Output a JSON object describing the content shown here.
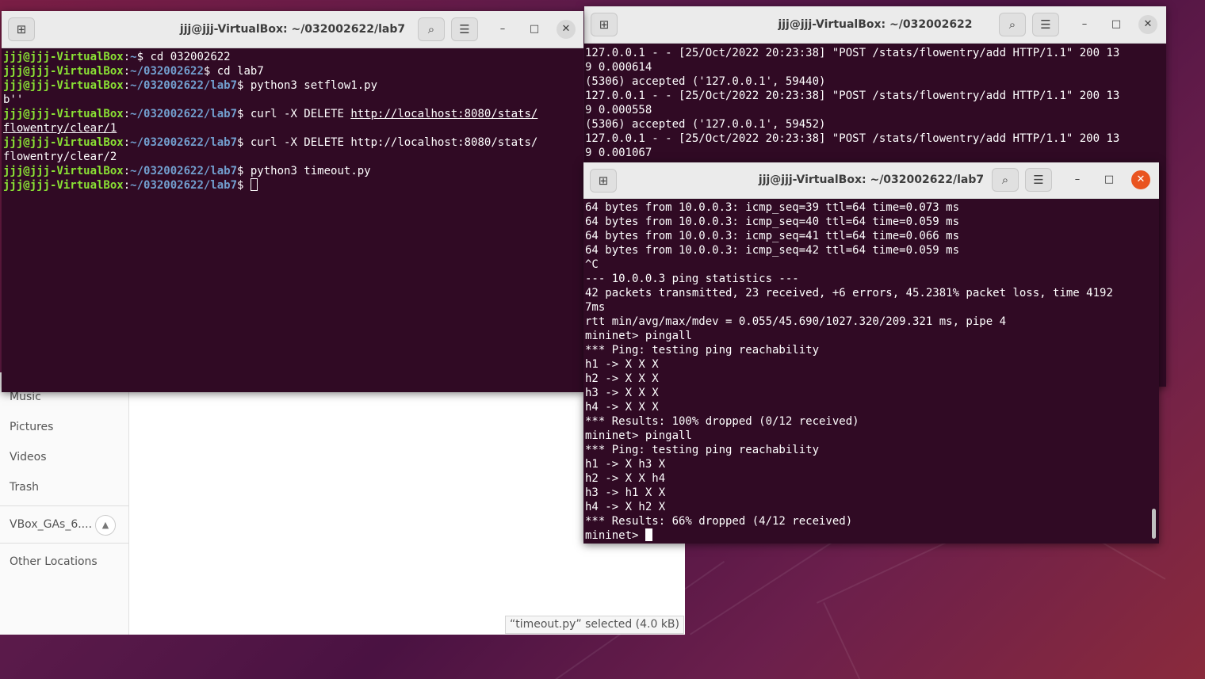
{
  "files": {
    "sidebar": [
      {
        "label": "Music"
      },
      {
        "label": "Pictures"
      },
      {
        "label": "Videos"
      },
      {
        "label": "Trash"
      },
      {
        "label": "VBox_GAs_6...."
      },
      {
        "label": "Other Locations"
      }
    ],
    "eject_icon": "eject-icon",
    "status": "“timeout.py” selected  (4.0 kB)"
  },
  "term1": {
    "title": "jjj@jjj-VirtualBox: ~/032002622/lab7",
    "user": "jjj@jjj-VirtualBox",
    "lines": [
      {
        "path": "~",
        "cmd": " cd 032002622"
      },
      {
        "path": "~/032002622",
        "cmd": " cd lab7"
      },
      {
        "path": "~/032002622/lab7",
        "cmd": " python3 setflow1.py"
      },
      {
        "text": "b''"
      },
      {
        "path": "~/032002622/lab7",
        "cmd": " curl -X DELETE ",
        "link": "http://localhost:8080/stats/"
      },
      {
        "textlink": "flowentry/clear/1"
      },
      {
        "path": "~/032002622/lab7",
        "cmd": " curl -X DELETE http://localhost:8080/stats/"
      },
      {
        "text": "flowentry/clear/2"
      },
      {
        "path": "~/032002622/lab7",
        "cmd": " python3 timeout.py"
      },
      {
        "path": "~/032002622/lab7",
        "cmd": " ",
        "cursor": true
      }
    ]
  },
  "term2": {
    "title": "jjj@jjj-VirtualBox: ~/032002622",
    "lines": [
      "127.0.0.1 - - [25/Oct/2022 20:23:38] \"POST /stats/flowentry/add HTTP/1.1\" 200 13",
      "9 0.000614",
      "(5306) accepted ('127.0.0.1', 59440)",
      "127.0.0.1 - - [25/Oct/2022 20:23:38] \"POST /stats/flowentry/add HTTP/1.1\" 200 13",
      "9 0.000558",
      "(5306) accepted ('127.0.0.1', 59452)",
      "127.0.0.1 - - [25/Oct/2022 20:23:38] \"POST /stats/flowentry/add HTTP/1.1\" 200 13",
      "9 0.001067"
    ]
  },
  "term3": {
    "title": "jjj@jjj-VirtualBox: ~/032002622/lab7",
    "lines": [
      "64 bytes from 10.0.0.3: icmp_seq=39 ttl=64 time=0.073 ms",
      "64 bytes from 10.0.0.3: icmp_seq=40 ttl=64 time=0.059 ms",
      "64 bytes from 10.0.0.3: icmp_seq=41 ttl=64 time=0.066 ms",
      "64 bytes from 10.0.0.3: icmp_seq=42 ttl=64 time=0.059 ms",
      "^C",
      "--- 10.0.0.3 ping statistics ---",
      "42 packets transmitted, 23 received, +6 errors, 45.2381% packet loss, time 4192",
      "7ms",
      "rtt min/avg/max/mdev = 0.055/45.690/1027.320/209.321 ms, pipe 4",
      "mininet> pingall",
      "*** Ping: testing ping reachability",
      "h1 -> X X X",
      "h2 -> X X X",
      "h3 -> X X X",
      "h4 -> X X X",
      "*** Results: 100% dropped (0/12 received)",
      "mininet> pingall",
      "*** Ping: testing ping reachability",
      "h1 -> X h3 X",
      "h2 -> X X h4",
      "h3 -> h1 X X",
      "h4 -> X h2 X",
      "*** Results: 66% dropped (4/12 received)"
    ],
    "prompt": "mininet> "
  },
  "icons": {
    "new_tab": "⊞",
    "search": "⌕",
    "menu": "☰",
    "minimize": "–",
    "maximize": "□",
    "close": "✕"
  }
}
